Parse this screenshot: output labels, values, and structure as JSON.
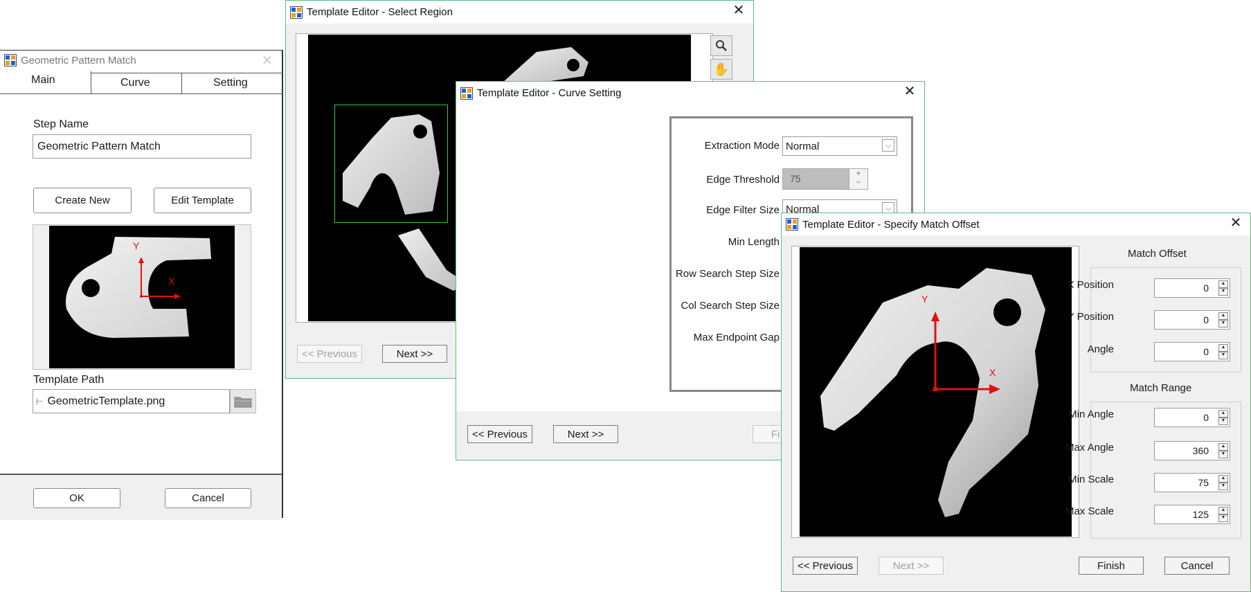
{
  "gpm": {
    "title": "Geometric Pattern Match",
    "tabs": [
      "Main",
      "Curve",
      "Setting"
    ],
    "step_name_label": "Step Name",
    "step_name_value": "Geometric Pattern Match",
    "create_new": "Create New",
    "edit_template": "Edit Template",
    "axis_x": "X",
    "axis_y": "Y",
    "template_path_label": "Template Path",
    "template_path_value": "GeometricTemplate.png",
    "ok": "OK",
    "cancel": "Cancel"
  },
  "select_region": {
    "title": "Template Editor - Select Region",
    "previous": "<< Previous",
    "next": "Next >>",
    "tools": [
      "zoom-icon",
      "hand-pan-icon"
    ]
  },
  "curve_setting": {
    "title": "Template Editor - Curve Setting",
    "extraction_mode_label": "Extraction Mode",
    "extraction_mode_value": "Normal",
    "edge_threshold_label": "Edge Threshold",
    "edge_threshold_value": "75",
    "edge_filter_size_label": "Edge Filter Size",
    "edge_filter_size_value": "Normal",
    "min_length_label": "Min Length",
    "row_search_step_label": "Row Search Step Size",
    "col_search_step_label": "Col Search Step Size",
    "max_endpoint_gap_label": "Max Endpoint Gap",
    "previous": "<< Previous",
    "next": "Next >>",
    "finish_partial": "Fi"
  },
  "match_offset": {
    "title": "Template Editor - Specify Match Offset",
    "match_offset_heading": "Match Offset",
    "x_position_label": "X Position",
    "x_position_value": "0",
    "y_position_label": "Y Position",
    "y_position_value": "0",
    "angle_label": "Angle",
    "angle_value": "0",
    "match_range_heading": "Match Range",
    "min_angle_label": "Min Angle",
    "min_angle_value": "0",
    "max_angle_label": "Max Angle",
    "max_angle_value": "360",
    "min_scale_label": "Min Scale",
    "min_scale_value": "75",
    "max_scale_label": "Max Scale",
    "max_scale_value": "125",
    "axis_x": "X",
    "axis_y": "Y",
    "previous": "<< Previous",
    "next": "Next >>",
    "finish": "Finish",
    "cancel": "Cancel"
  },
  "colors": {
    "accent_border": "#5fb886",
    "axis_red": "#e01010",
    "roi_green": "#33cc33"
  }
}
